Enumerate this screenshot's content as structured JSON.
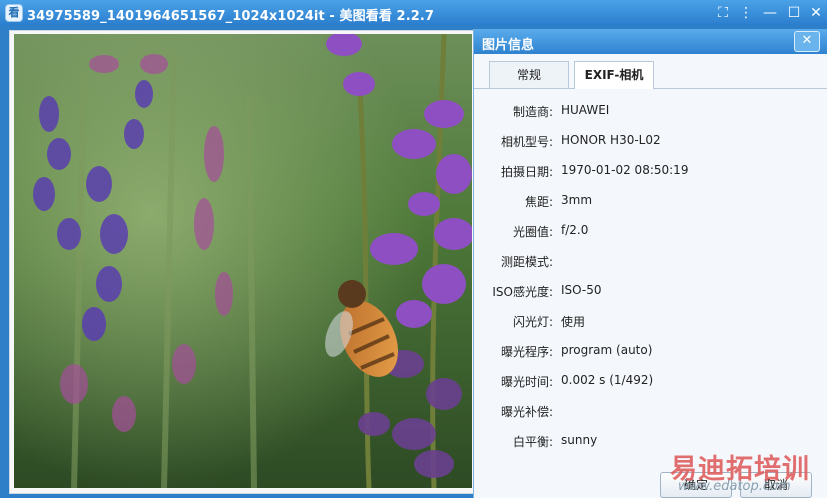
{
  "window": {
    "title": "34975589_1401964651567_1024x1024it - 美图看看 2.2.7",
    "app_icon_glyph": "看",
    "buttons": {
      "fit": "⛶",
      "menu": "⋮",
      "minimize": "—",
      "maximize": "☐",
      "close": "✕"
    }
  },
  "panel": {
    "title": "图片信息",
    "close_glyph": "✕",
    "tabs": [
      {
        "label": "常规",
        "active": false
      },
      {
        "label": "EXIF-相机",
        "active": true
      }
    ],
    "properties": [
      {
        "label": "制造商:",
        "value": "HUAWEI"
      },
      {
        "label": "相机型号:",
        "value": "HONOR H30-L02"
      },
      {
        "label": "拍摄日期:",
        "value": "1970-01-02 08:50:19"
      },
      {
        "label": "焦距:",
        "value": "3mm"
      },
      {
        "label": "光圈值:",
        "value": "f/2.0"
      },
      {
        "label": "测距模式:",
        "value": ""
      },
      {
        "label": "ISO感光度:",
        "value": "ISO-50"
      },
      {
        "label": "闪光灯:",
        "value": "使用"
      },
      {
        "label": "曝光程序:",
        "value": "program (auto)"
      },
      {
        "label": "曝光时间:",
        "value": "0.002 s  (1/492)"
      },
      {
        "label": "曝光补偿:",
        "value": ""
      },
      {
        "label": "白平衡:",
        "value": "sunny"
      }
    ],
    "ok_label": "确定",
    "cancel_label": "取消"
  },
  "watermark": {
    "big": "易迪拓培训",
    "small": "www.edatop.com"
  },
  "colors": {
    "titlebar": "#2a7dcc",
    "panel_bg": "#f4f8fc",
    "accent": "#4aa2e8"
  }
}
